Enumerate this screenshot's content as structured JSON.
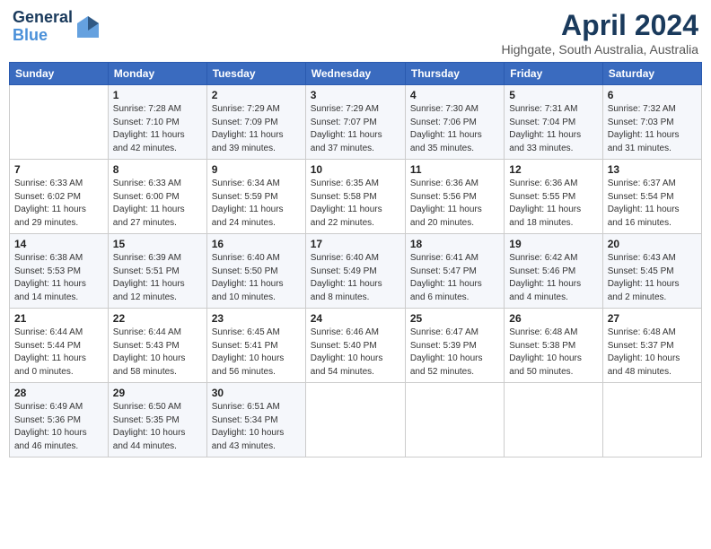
{
  "header": {
    "logo_line1": "General",
    "logo_line2": "Blue",
    "month": "April 2024",
    "location": "Highgate, South Australia, Australia"
  },
  "weekdays": [
    "Sunday",
    "Monday",
    "Tuesday",
    "Wednesday",
    "Thursday",
    "Friday",
    "Saturday"
  ],
  "weeks": [
    [
      {
        "day": "",
        "info": ""
      },
      {
        "day": "1",
        "info": "Sunrise: 7:28 AM\nSunset: 7:10 PM\nDaylight: 11 hours\nand 42 minutes."
      },
      {
        "day": "2",
        "info": "Sunrise: 7:29 AM\nSunset: 7:09 PM\nDaylight: 11 hours\nand 39 minutes."
      },
      {
        "day": "3",
        "info": "Sunrise: 7:29 AM\nSunset: 7:07 PM\nDaylight: 11 hours\nand 37 minutes."
      },
      {
        "day": "4",
        "info": "Sunrise: 7:30 AM\nSunset: 7:06 PM\nDaylight: 11 hours\nand 35 minutes."
      },
      {
        "day": "5",
        "info": "Sunrise: 7:31 AM\nSunset: 7:04 PM\nDaylight: 11 hours\nand 33 minutes."
      },
      {
        "day": "6",
        "info": "Sunrise: 7:32 AM\nSunset: 7:03 PM\nDaylight: 11 hours\nand 31 minutes."
      }
    ],
    [
      {
        "day": "7",
        "info": "Sunrise: 6:33 AM\nSunset: 6:02 PM\nDaylight: 11 hours\nand 29 minutes."
      },
      {
        "day": "8",
        "info": "Sunrise: 6:33 AM\nSunset: 6:00 PM\nDaylight: 11 hours\nand 27 minutes."
      },
      {
        "day": "9",
        "info": "Sunrise: 6:34 AM\nSunset: 5:59 PM\nDaylight: 11 hours\nand 24 minutes."
      },
      {
        "day": "10",
        "info": "Sunrise: 6:35 AM\nSunset: 5:58 PM\nDaylight: 11 hours\nand 22 minutes."
      },
      {
        "day": "11",
        "info": "Sunrise: 6:36 AM\nSunset: 5:56 PM\nDaylight: 11 hours\nand 20 minutes."
      },
      {
        "day": "12",
        "info": "Sunrise: 6:36 AM\nSunset: 5:55 PM\nDaylight: 11 hours\nand 18 minutes."
      },
      {
        "day": "13",
        "info": "Sunrise: 6:37 AM\nSunset: 5:54 PM\nDaylight: 11 hours\nand 16 minutes."
      }
    ],
    [
      {
        "day": "14",
        "info": "Sunrise: 6:38 AM\nSunset: 5:53 PM\nDaylight: 11 hours\nand 14 minutes."
      },
      {
        "day": "15",
        "info": "Sunrise: 6:39 AM\nSunset: 5:51 PM\nDaylight: 11 hours\nand 12 minutes."
      },
      {
        "day": "16",
        "info": "Sunrise: 6:40 AM\nSunset: 5:50 PM\nDaylight: 11 hours\nand 10 minutes."
      },
      {
        "day": "17",
        "info": "Sunrise: 6:40 AM\nSunset: 5:49 PM\nDaylight: 11 hours\nand 8 minutes."
      },
      {
        "day": "18",
        "info": "Sunrise: 6:41 AM\nSunset: 5:47 PM\nDaylight: 11 hours\nand 6 minutes."
      },
      {
        "day": "19",
        "info": "Sunrise: 6:42 AM\nSunset: 5:46 PM\nDaylight: 11 hours\nand 4 minutes."
      },
      {
        "day": "20",
        "info": "Sunrise: 6:43 AM\nSunset: 5:45 PM\nDaylight: 11 hours\nand 2 minutes."
      }
    ],
    [
      {
        "day": "21",
        "info": "Sunrise: 6:44 AM\nSunset: 5:44 PM\nDaylight: 11 hours\nand 0 minutes."
      },
      {
        "day": "22",
        "info": "Sunrise: 6:44 AM\nSunset: 5:43 PM\nDaylight: 10 hours\nand 58 minutes."
      },
      {
        "day": "23",
        "info": "Sunrise: 6:45 AM\nSunset: 5:41 PM\nDaylight: 10 hours\nand 56 minutes."
      },
      {
        "day": "24",
        "info": "Sunrise: 6:46 AM\nSunset: 5:40 PM\nDaylight: 10 hours\nand 54 minutes."
      },
      {
        "day": "25",
        "info": "Sunrise: 6:47 AM\nSunset: 5:39 PM\nDaylight: 10 hours\nand 52 minutes."
      },
      {
        "day": "26",
        "info": "Sunrise: 6:48 AM\nSunset: 5:38 PM\nDaylight: 10 hours\nand 50 minutes."
      },
      {
        "day": "27",
        "info": "Sunrise: 6:48 AM\nSunset: 5:37 PM\nDaylight: 10 hours\nand 48 minutes."
      }
    ],
    [
      {
        "day": "28",
        "info": "Sunrise: 6:49 AM\nSunset: 5:36 PM\nDaylight: 10 hours\nand 46 minutes."
      },
      {
        "day": "29",
        "info": "Sunrise: 6:50 AM\nSunset: 5:35 PM\nDaylight: 10 hours\nand 44 minutes."
      },
      {
        "day": "30",
        "info": "Sunrise: 6:51 AM\nSunset: 5:34 PM\nDaylight: 10 hours\nand 43 minutes."
      },
      {
        "day": "",
        "info": ""
      },
      {
        "day": "",
        "info": ""
      },
      {
        "day": "",
        "info": ""
      },
      {
        "day": "",
        "info": ""
      }
    ]
  ]
}
